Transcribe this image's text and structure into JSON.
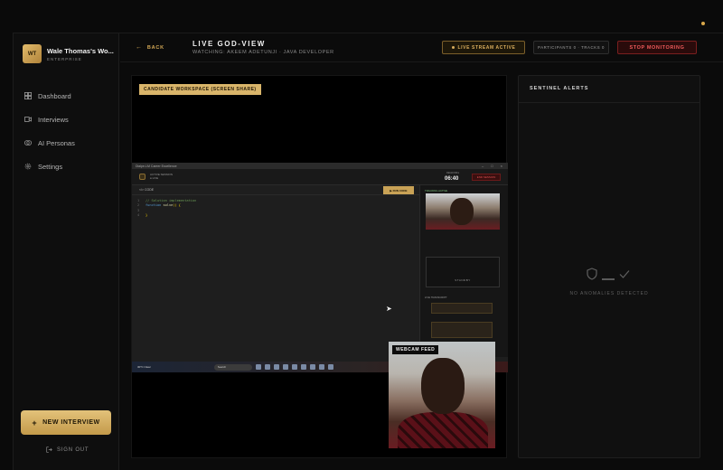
{
  "brand": {
    "logo": "WT",
    "name": "Wale Thomas's Wo...",
    "sub": "ENTERPRISE"
  },
  "nav": [
    {
      "label": "Dashboard",
      "icon": "dashboard-icon"
    },
    {
      "label": "Interviews",
      "icon": "video-icon"
    },
    {
      "label": "AI Personas",
      "icon": "brain-icon"
    },
    {
      "label": "Settings",
      "icon": "gear-icon"
    }
  ],
  "sidebar": {
    "new_interview": "NEW INTERVIEW",
    "sign_out": "SIGN OUT"
  },
  "header": {
    "back": "BACK",
    "title": "LIVE GOD-VIEW",
    "watching": "WATCHING: AKEEM ADETUNJI · JAVA DEVELOPER",
    "live_badge": "LIVE STREAM ACTIVE",
    "counts": "PARTICIPANTS 0 · TRACKS 0",
    "stop": "STOP MONITORING"
  },
  "share": {
    "label": "CANDIDATE WORKSPACE (SCREEN SHARE)",
    "window_title": "Dialpe-LM Career Excellence",
    "session_line1": "ACTIVE SESSION",
    "session_line2": "● LIVE",
    "timer_label": "REMAINING",
    "timer": "06:40",
    "end_button": "END SESSION",
    "code_label": "</> CODE",
    "run_button": "▶ RUN CODE",
    "code": [
      {
        "n": "1",
        "text": "// Solution implementation"
      },
      {
        "n": "2",
        "kw": "function",
        "fn": " solve",
        "rest": "() {"
      },
      {
        "n": "3",
        "text": ""
      },
      {
        "n": "4",
        "text": "}"
      }
    ],
    "tracking_label": "TRACKING ACTIVE",
    "standby": "STANDBY",
    "transcript_label": "LIVE TRANSCRIPT",
    "weather": "30°C Clear",
    "taskbar_search": "Search"
  },
  "webcam": {
    "label": "WEBCAM FEED"
  },
  "alerts": {
    "title": "SENTINEL ALERTS",
    "empty": "NO ANOMALIES DETECTED"
  },
  "colors": {
    "accent": "#d9b56a",
    "danger": "#ef5a5a",
    "background": "#0b0b0b"
  }
}
